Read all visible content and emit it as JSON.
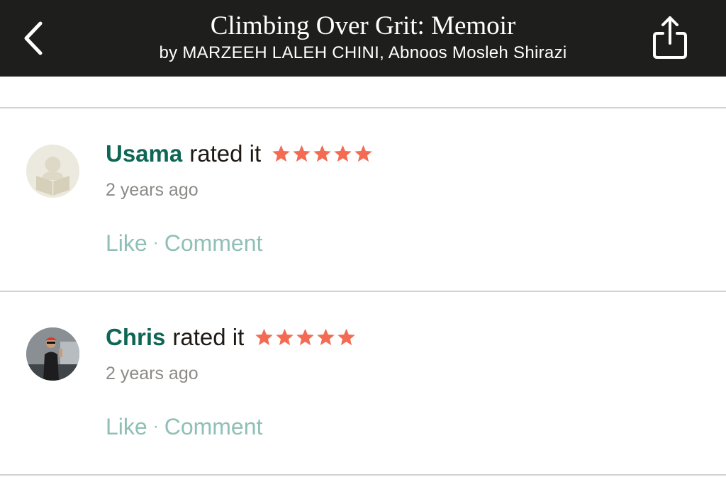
{
  "header": {
    "title": "Climbing Over Grit: Memoir",
    "subtitle": "by MARZEEH LALEH CHINI, Abnoos Mosleh Shirazi",
    "background_color": "#1e1e1d",
    "back_icon": "chevron-left-icon",
    "share_icon": "share-icon"
  },
  "colors": {
    "username": "#0e6656",
    "star": "#f26b52",
    "action": "#8fbfb6",
    "timestamp": "#8c8a86"
  },
  "activity": [
    {
      "user": "Usama",
      "action_text": "rated it",
      "rating": 5,
      "time": "2 years ago",
      "like_label": "Like",
      "separator": "·",
      "comment_label": "Comment",
      "avatar": "default-reader-avatar"
    },
    {
      "user": "Chris",
      "action_text": "rated it",
      "rating": 5,
      "time": "2 years ago",
      "like_label": "Like",
      "separator": "·",
      "comment_label": "Comment",
      "avatar": "user-photo-avatar"
    }
  ]
}
